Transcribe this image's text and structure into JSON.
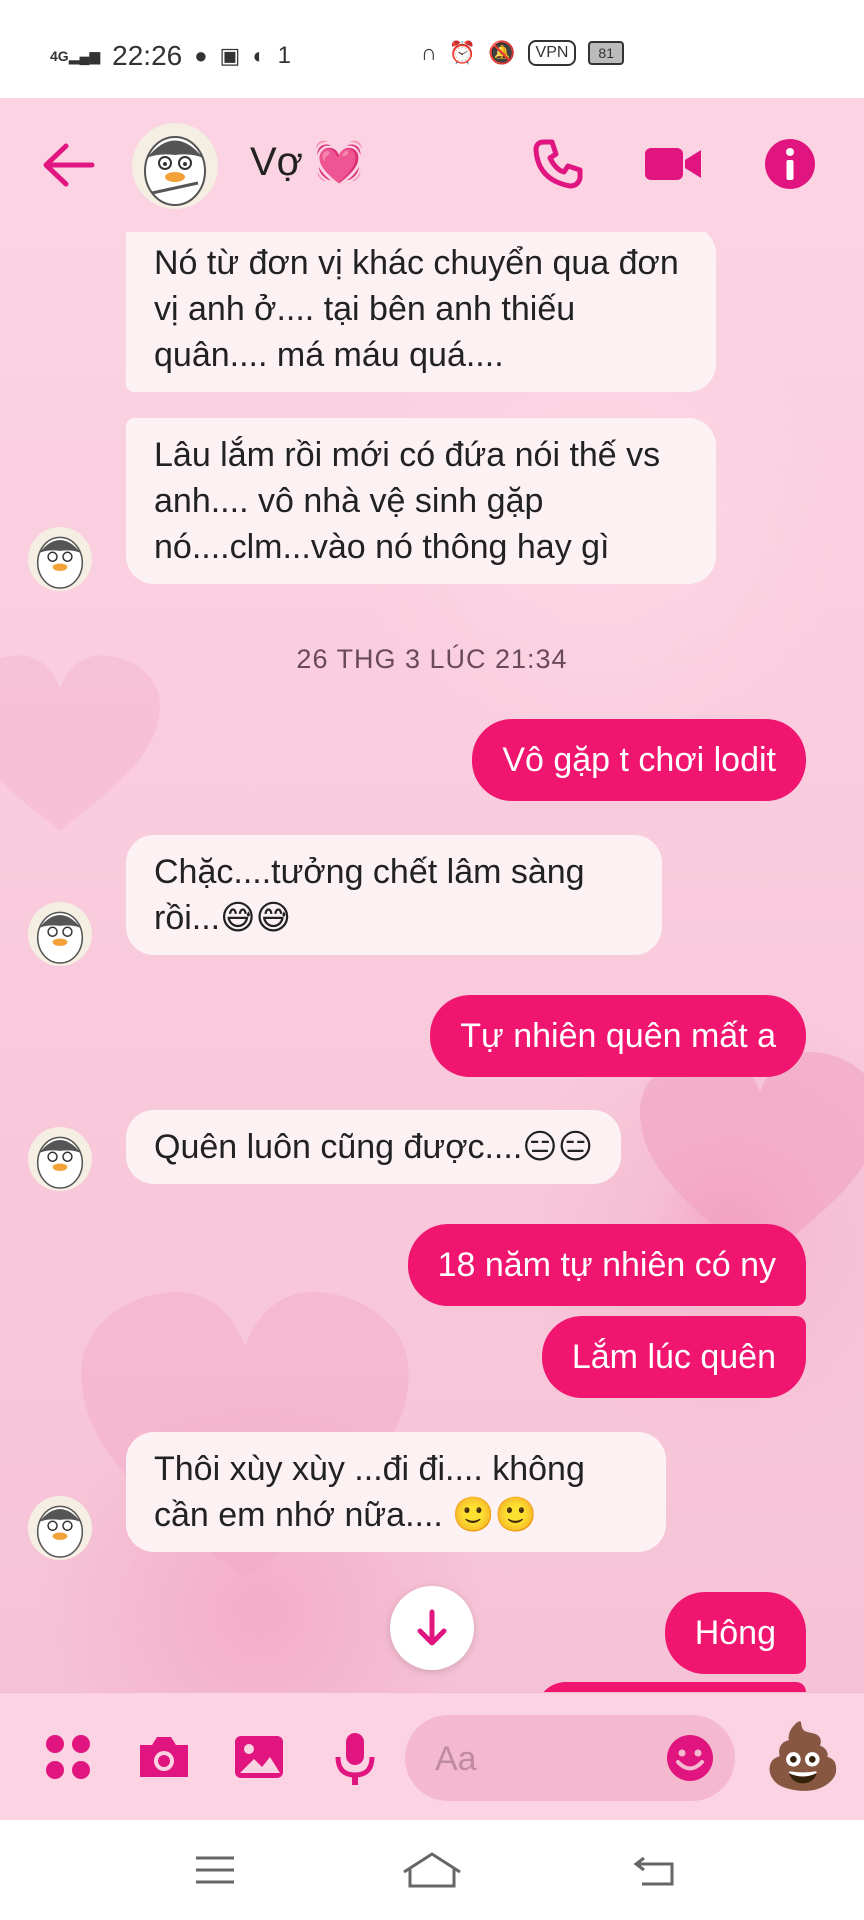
{
  "status_bar": {
    "network": "4G",
    "time": "22:26",
    "notif_count": "1",
    "vpn": "VPN",
    "battery": "81"
  },
  "header": {
    "contact_name": "Vợ 💓"
  },
  "messages": [
    {
      "side": "received",
      "text": "Nó từ đơn vị khác chuyển qua đơn vị anh ở.... tại bên anh thiếu quân.... má máu quá...."
    },
    {
      "side": "received",
      "text": "Lâu lắm rồi mới có đứa nói thế vs anh.... vô nhà vệ sinh gặp nó....clm...vào nó thông hay gì"
    },
    {
      "type": "timestamp",
      "text": "26 THG 3 LÚC 21:34"
    },
    {
      "side": "sent",
      "text": "Vô gặp t chơi lodit"
    },
    {
      "side": "received",
      "text": "Chặc....tưởng chết lâm sàng rồi...😅😅"
    },
    {
      "side": "sent",
      "text": "Tự nhiên quên mất a"
    },
    {
      "side": "received",
      "text": "Quên luôn cũng được....😑😑"
    },
    {
      "side": "sent",
      "text": "18 năm tự nhiên có ny"
    },
    {
      "side": "sent",
      "text": "Lắm lúc quên"
    },
    {
      "side": "received",
      "text": "Thôi xùy xùy ...đi đi.... không cần em nhớ nữa.... 🙂🙂"
    },
    {
      "side": "sent",
      "text": "Hông"
    }
  ],
  "composer": {
    "placeholder": "Aa",
    "quick_reaction": "💩"
  },
  "colors": {
    "accent": "#e0157f",
    "sent_bubble": "#f0156f",
    "received_bubble": "#fcf2f4",
    "header_bg": "#fbd3e3"
  },
  "icons": [
    "back-arrow-icon",
    "phone-icon",
    "video-camera-icon",
    "info-icon",
    "apps-icon",
    "camera-icon",
    "image-icon",
    "microphone-icon",
    "emoji-icon",
    "arrow-down-icon",
    "menu-icon",
    "home-icon",
    "back-icon"
  ]
}
